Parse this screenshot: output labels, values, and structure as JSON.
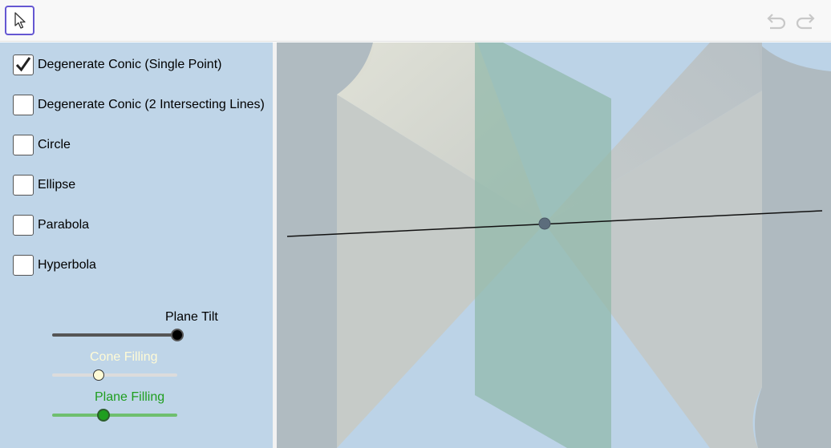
{
  "toolbar": {
    "move_tool": "move-tool-arrow-icon",
    "undo_icon": "undo-icon",
    "redo_icon": "redo-icon"
  },
  "checkboxes": [
    {
      "label": "Degenerate Conic (Single Point)",
      "checked": true
    },
    {
      "label": "Degenerate Conic (2 Intersecting Lines)",
      "checked": false
    },
    {
      "label": "Circle",
      "checked": false
    },
    {
      "label": "Ellipse",
      "checked": false
    },
    {
      "label": "Parabola",
      "checked": false
    },
    {
      "label": "Hyperbola",
      "checked": false
    }
  ],
  "sliders": {
    "plane_tilt": {
      "label": "Plane Tilt",
      "color": "#000000",
      "value_fraction": 1.0
    },
    "cone_filling": {
      "label": "Cone Filling",
      "color": "#fffbd6",
      "value_fraction": 0.37
    },
    "plane_filling": {
      "label": "Plane Filling",
      "color": "#1f9e1f",
      "value_fraction": 0.41
    }
  },
  "colors": {
    "algebra_bg": "#bfd5e8",
    "graphics_bg": "#bcd3e7",
    "toolbar_accent": "#6557d2",
    "plane": "#8fb8a8",
    "cone": "#d8d8cc",
    "vertex_point": "#5c6d7c"
  }
}
